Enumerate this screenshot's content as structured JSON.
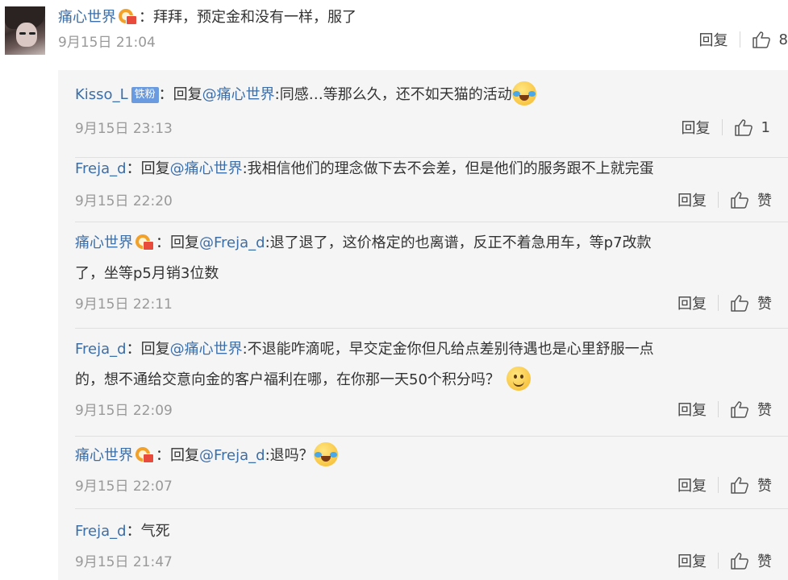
{
  "top_comment": {
    "username": "痛心世界",
    "text": "：拜拜，预定金和没有一样，服了",
    "date": "9月15日 21:04",
    "reply_label": "回复",
    "like_count": "8"
  },
  "replies": [
    {
      "username": "Kisso_L",
      "badge": "铁粉",
      "prefix": "：回复",
      "mention": "@痛心世界",
      "text": ":同感…等那么久，还不如天猫的活动",
      "emoji": "laugh-cry-emoji",
      "date": "9月15日 23:13",
      "reply_label": "回复",
      "like_label": "1"
    },
    {
      "username": "Freja_d",
      "prefix": "：回复",
      "mention": "@痛心世界",
      "text": ":我相信他们的理念做下去不会差，但是他们的服务跟不上就完蛋",
      "date": "9月15日 22:20",
      "reply_label": "回复",
      "like_label": "赞"
    },
    {
      "username": "痛心世界",
      "prefix": "：回复",
      "mention": "@Freja_d",
      "text": ":退了退了，这价格定的也离谱，反正不着急用车，等p7改款",
      "text2": "了，坐等p5月销3位数",
      "date": "9月15日 22:11",
      "reply_label": "回复",
      "like_label": "赞"
    },
    {
      "username": "Freja_d",
      "prefix": "：回复",
      "mention": "@痛心世界",
      "text": ":不退能咋滴呢，早交定金你但凡给点差别待遇也是心里舒服一点",
      "text2": "的，想不通给交意向金的客户福利在哪，在你那一天50个积分吗？",
      "emoji": "smile-emoji",
      "date": "9月15日 22:09",
      "reply_label": "回复",
      "like_label": "赞"
    },
    {
      "username": "痛心世界",
      "prefix": "：回复",
      "mention": "@Freja_d",
      "text": ":退吗？",
      "emoji": "laugh-cry-emoji",
      "date": "9月15日 22:07",
      "reply_label": "回复",
      "like_label": "赞"
    },
    {
      "username": "Freja_d",
      "prefix": "：",
      "mention": "",
      "text": "气死",
      "date": "9月15日 21:47",
      "reply_label": "回复",
      "like_label": "赞"
    }
  ],
  "colors": {
    "link": "#3c6ea8",
    "date": "#999999",
    "thread_bg": "#f5f5f5",
    "fan_badge": "#6a9be0"
  }
}
